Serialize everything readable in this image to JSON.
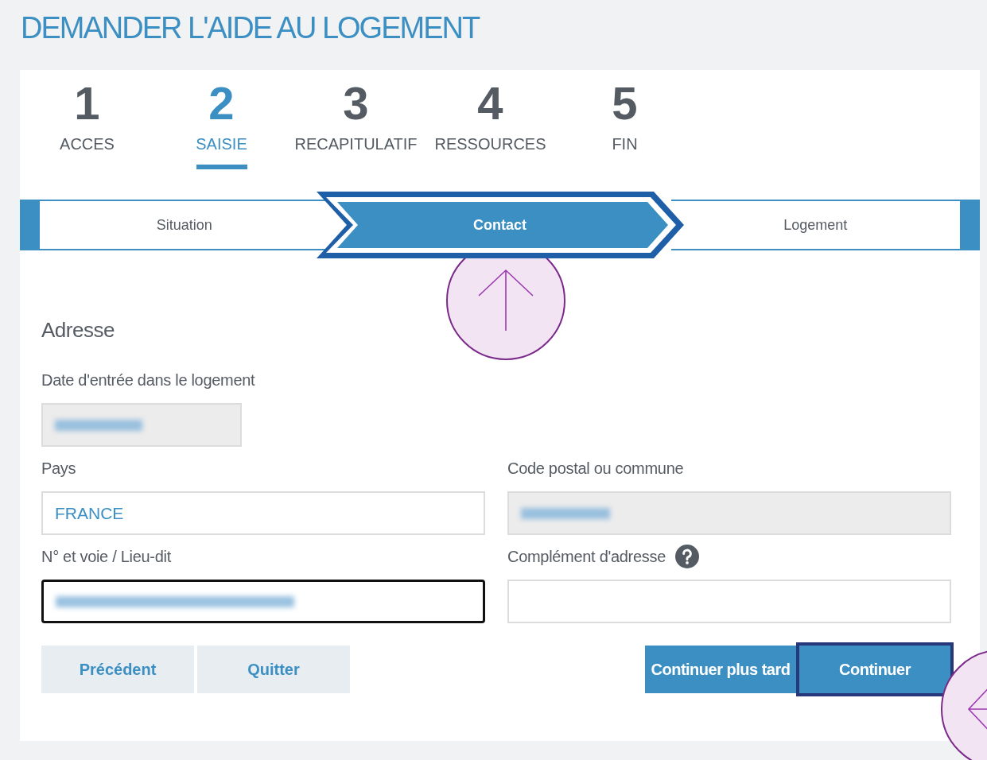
{
  "title": "DEMANDER L'AIDE AU LOGEMENT",
  "steps": [
    {
      "number": "1",
      "label": "ACCES",
      "selected": false
    },
    {
      "number": "2",
      "label": "SAISIE",
      "selected": true
    },
    {
      "number": "3",
      "label": "RECAPITULATIF",
      "selected": false
    },
    {
      "number": "4",
      "label": "RESSOURCES",
      "selected": false
    },
    {
      "number": "5",
      "label": "FIN",
      "selected": false
    }
  ],
  "substeps": [
    {
      "label": "Situation",
      "selected": false
    },
    {
      "label": "Contact",
      "selected": true
    },
    {
      "label": "Logement",
      "selected": false
    }
  ],
  "section_title": "Adresse",
  "field_rows": [
    [
      {
        "kind": "date",
        "label": "Date d'entrée dans le logement",
        "redacted": true,
        "disabled": true,
        "focused": false,
        "help": false
      }
    ],
    [
      {
        "kind": "text",
        "label": "Pays",
        "value": "FRANCE",
        "redacted": false,
        "disabled": false,
        "focused": false,
        "help": false
      },
      {
        "kind": "text",
        "label": "Code postal ou commune",
        "redacted": true,
        "disabled": true,
        "focused": false,
        "help": false
      }
    ],
    [
      {
        "kind": "text",
        "label": "N° et voie / Lieu-dit",
        "redacted": true,
        "disabled": false,
        "focused": true,
        "help": false
      },
      {
        "kind": "text",
        "label": "Complément d'adresse",
        "redacted": false,
        "disabled": false,
        "focused": false,
        "help": true
      }
    ]
  ],
  "buttons_left": [
    {
      "label": "Précédent",
      "kind": "secondary",
      "highlighted": false
    },
    {
      "label": "Quitter",
      "kind": "secondary",
      "highlighted": false
    }
  ],
  "buttons_right": [
    {
      "label": "Continuer plus tard",
      "kind": "primary",
      "highlighted": false
    },
    {
      "label": "Continuer",
      "kind": "primary",
      "highlighted": true
    }
  ]
}
